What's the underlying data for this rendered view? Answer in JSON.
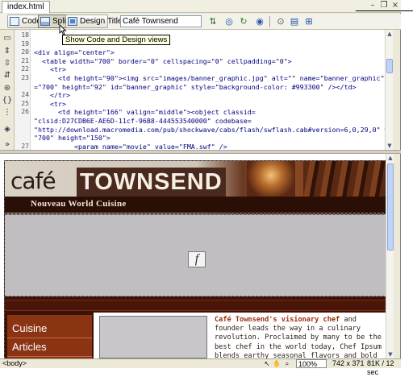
{
  "document": {
    "tab_label": "index.html"
  },
  "window_controls": {
    "minimize": "–",
    "restore": "❐",
    "close": "×"
  },
  "toolbar": {
    "code_label": "Code",
    "split_label": "Split",
    "design_label": "Design",
    "title_label": "Title:",
    "title_value": "Café Townsend",
    "tooltip": "Show Code and Design views"
  },
  "code_view": {
    "lines": [
      {
        "n": "18",
        "text": ""
      },
      {
        "n": "19",
        "text": ""
      },
      {
        "n": "20",
        "text": "<div align=\"center\">"
      },
      {
        "n": "21",
        "text": "  <table width=\"700\" border=\"0\" cellspacing=\"0\" cellpadding=\"0\">"
      },
      {
        "n": "22",
        "text": "    <tr>"
      },
      {
        "n": "23",
        "text": "      <td height=\"90\"><img src=\"images/banner_graphic.jpg\" alt=\"\" name=\"banner_graphic\" width"
      },
      {
        "n": "",
        "text": "=\"700\" height=\"92\" id=\"banner_graphic\" style=\"background-color: #993300\" /></td>"
      },
      {
        "n": "24",
        "text": "    </tr>"
      },
      {
        "n": "25",
        "text": "    <tr>"
      },
      {
        "n": "26",
        "text": "      <td height=\"166\" valign=\"middle\"><object classid="
      },
      {
        "n": "",
        "text": "\"clsid:D27CDB6E-AE6D-11cf-96B8-444553540000\" codebase="
      },
      {
        "n": "",
        "text": "\"http://download.macromedia.com/pub/shockwave/cabs/flash/swflash.cab#version=6,0,29,0\" width="
      },
      {
        "n": "",
        "text": "\"700\" height=\"150\">"
      },
      {
        "n": "27",
        "text": "          <param name=\"movie\" value=\"FMA.swf\" />"
      }
    ]
  },
  "design_view": {
    "banner_cafe": "café",
    "banner_name": "TOWNSEND",
    "banner_sub": "Nouveau World Cuisine",
    "nav_items": [
      "Cuisine",
      "Articles"
    ],
    "content_bold": "Café Townsend's visionary chef",
    "content_rest": " and founder leads the way in a culinary revolution. Proclaimed by many to be the best chef in the world today, Chef Ipsum blends earthy seasonal flavors and bold"
  },
  "status_bar": {
    "tag": "<body>",
    "zoom": "100%",
    "dimensions": "742 x 371",
    "size": "81K / 12 sec"
  }
}
